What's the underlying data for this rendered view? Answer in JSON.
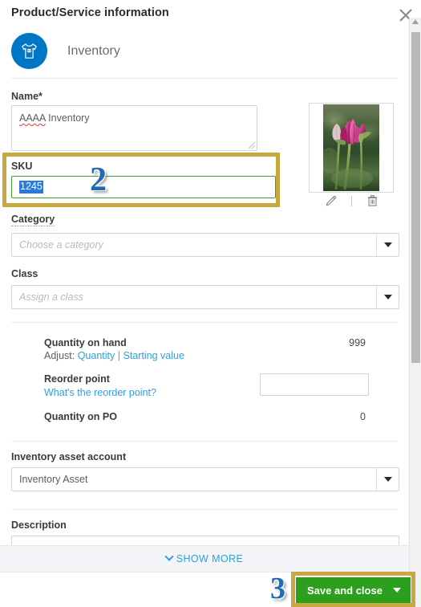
{
  "panel": {
    "title": "Product/Service information",
    "close_icon": "close-icon"
  },
  "type_row": {
    "icon": "tshirt-icon",
    "label": "Inventory"
  },
  "fields": {
    "name": {
      "label": "Name*",
      "value_misspelled": "AAAA",
      "value_rest": " Inventory"
    },
    "sku": {
      "label": "SKU",
      "value": "1245",
      "selected": true
    },
    "category": {
      "label": "Category",
      "placeholder": "Choose a category",
      "value": ""
    },
    "class": {
      "label": "Class",
      "placeholder": "Assign a class",
      "value": ""
    },
    "inventory_asset_account": {
      "label": "Inventory asset account",
      "value": "Inventory Asset"
    },
    "description": {
      "label": "Description",
      "value": ""
    }
  },
  "image": {
    "alt": "tulip-flower-photo",
    "edit_icon": "pencil-icon",
    "delete_icon": "trash-icon"
  },
  "quantity": {
    "on_hand_label": "Quantity on hand",
    "on_hand_value": "999",
    "adjust_prefix": "Adjust:",
    "adjust_quantity_link": "Quantity",
    "adjust_separator": "|",
    "adjust_starting_value_link": "Starting value",
    "reorder_point_label": "Reorder point",
    "reorder_point_help_link": "What's the reorder point?",
    "reorder_point_value": "",
    "on_po_label": "Quantity on PO",
    "on_po_value": "0"
  },
  "show_more": {
    "label": "SHOW MORE",
    "icon": "chevron-down-icon"
  },
  "footer": {
    "save_label": "Save and close",
    "save_caret_icon": "caret-down-icon"
  },
  "annotations": {
    "step2": "2",
    "step3": "3",
    "box_color": "#c9a93f",
    "number_color": "#1f6bb5"
  },
  "colors": {
    "brand_blue": "#0077c5",
    "link_blue": "#2ca0e0",
    "save_green": "#2ca01c",
    "focus_green": "#3f9c35",
    "selection_blue": "#2a7ade"
  }
}
